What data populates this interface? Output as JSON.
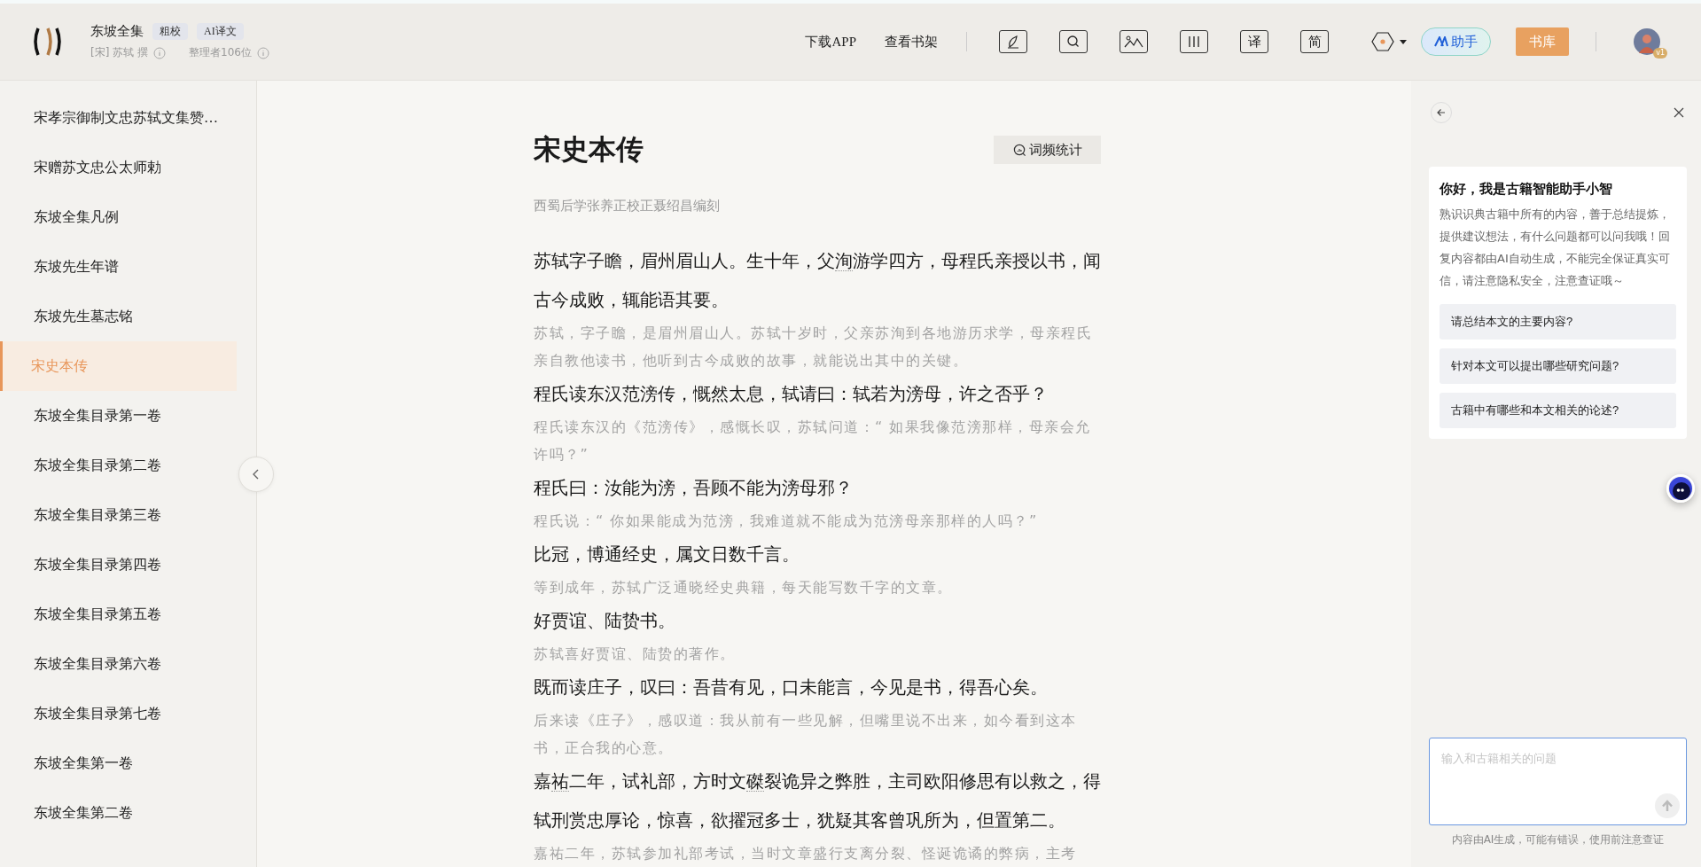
{
  "header": {
    "book_title": "东坡全集",
    "badges": [
      "粗校",
      "AI译文"
    ],
    "author": "[宋] 苏轼 撰",
    "editors": "整理者106位",
    "links": [
      "下载APP",
      "查看书架"
    ],
    "tools": [
      {
        "kind": "pen"
      },
      {
        "kind": "search"
      },
      {
        "kind": "image"
      },
      {
        "kind": "columns"
      },
      {
        "kind": "glyph",
        "label": "译"
      },
      {
        "kind": "glyph",
        "label": "简"
      }
    ],
    "assistant_button": "助手",
    "library_button": "书库",
    "avatar_badge": "v1"
  },
  "sidebar": {
    "items": [
      {
        "label": "宋孝宗御制文忠苏轼文集赞…",
        "selected": false
      },
      {
        "label": "宋赠苏文忠公太师勅",
        "selected": false
      },
      {
        "label": "东坡全集凡例",
        "selected": false
      },
      {
        "label": "东坡先生年谱",
        "selected": false
      },
      {
        "label": "东坡先生墓志铭",
        "selected": false
      },
      {
        "label": "宋史本传",
        "selected": true
      },
      {
        "label": "东坡全集目录第一卷",
        "selected": false
      },
      {
        "label": "东坡全集目录第二卷",
        "selected": false
      },
      {
        "label": "东坡全集目录第三卷",
        "selected": false
      },
      {
        "label": "东坡全集目录第四卷",
        "selected": false
      },
      {
        "label": "东坡全集目录第五卷",
        "selected": false
      },
      {
        "label": "东坡全集目录第六卷",
        "selected": false
      },
      {
        "label": "东坡全集目录第七卷",
        "selected": false
      },
      {
        "label": "东坡全集第一卷",
        "selected": false
      },
      {
        "label": "东坡全集第二卷",
        "selected": false
      }
    ]
  },
  "article": {
    "title": "宋史本传",
    "word_freq_button": "词频统计",
    "subtitle": "西蜀后学张养正校正聂绍昌编刻",
    "paragraphs": [
      {
        "original": [
          {
            "text": "苏轼字子瞻，眉州眉山人。生十年，父",
            "annotated": false
          },
          {
            "text": "洵",
            "annotated": true
          },
          {
            "text": "游学四方，母程氏亲授以书，闻古今成败，辄能语其要。",
            "annotated": false
          }
        ],
        "translation": "苏轼，字子瞻，是眉州眉山人。苏轼十岁时，父亲苏洵到各地游历求学，母亲程氏亲自教他读书，他听到古今成败的故事，就能说出其中的关键。"
      },
      {
        "original": [
          {
            "text": "程氏读东汉范滂传，慨然太息，轼请曰：轼若为滂母，许之否乎？",
            "annotated": false
          }
        ],
        "translation": "程氏读东汉的《范滂传》，感慨长叹，苏轼问道：“ 如果我像范滂那样，母亲会允许吗？”"
      },
      {
        "original": [
          {
            "text": "程氏曰：汝能为滂，吾顾不能为滂母邪？",
            "annotated": false
          }
        ],
        "translation": "程氏说：“ 你如果能成为范滂，我难道就不能成为范滂母亲那样的人吗？”"
      },
      {
        "original": [
          {
            "text": "比冠，博通经史，属文日数千言。",
            "annotated": false
          }
        ],
        "translation": "等到成年，苏轼广泛通晓经史典籍，每天能写数千字的文章。"
      },
      {
        "original": [
          {
            "text": "好贾谊、陆贽书。",
            "annotated": false
          }
        ],
        "translation": "苏轼喜好贾谊、陆贽的著作。"
      },
      {
        "original": [
          {
            "text": "既而读庄子，叹曰：吾昔有见，口未能言，今见是书，得吾心矣。",
            "annotated": false
          }
        ],
        "translation": "后来读《庄子》，感叹道：我从前有一些见解，但嘴里说不出来，如今看到这本书，正合我的心意。"
      },
      {
        "original": [
          {
            "text": "嘉",
            "annotated": false
          },
          {
            "text": "祐",
            "annotated": true
          },
          {
            "text": "二年，试礼部，方时文",
            "annotated": false
          },
          {
            "text": "磔",
            "annotated": true
          },
          {
            "text": "裂诡异之弊胜，主司欧阳修思有以救之，得轼刑赏忠厚论，惊喜，欲擢冠多士，犹疑其客曾巩所为，但置第二。",
            "annotated": false
          }
        ],
        "translation": "嘉祐二年，苏轼参加礼部考试，当时文章盛行支离分裂、怪诞诡谲的弊病，主考"
      }
    ]
  },
  "assistant": {
    "greeting_title": "你好，我是古籍智能助手小智",
    "greeting_text": "熟识识典古籍中所有的内容，善于总结提炼，提供建议想法，有什么问题都可以问我哦！回复内容都由AI自动生成，不能完全保证真实可信，请注意隐私安全，注意查证哦～",
    "suggestions": [
      "请总结本文的主要内容?",
      "针对本文可以提出哪些研究问题?",
      "古籍中有哪些和本文相关的论述?"
    ],
    "input": {
      "placeholder": "输入和古籍相关的问题"
    },
    "disclaimer": "内容由AI生成，可能有错误，使用前注意查证"
  }
}
